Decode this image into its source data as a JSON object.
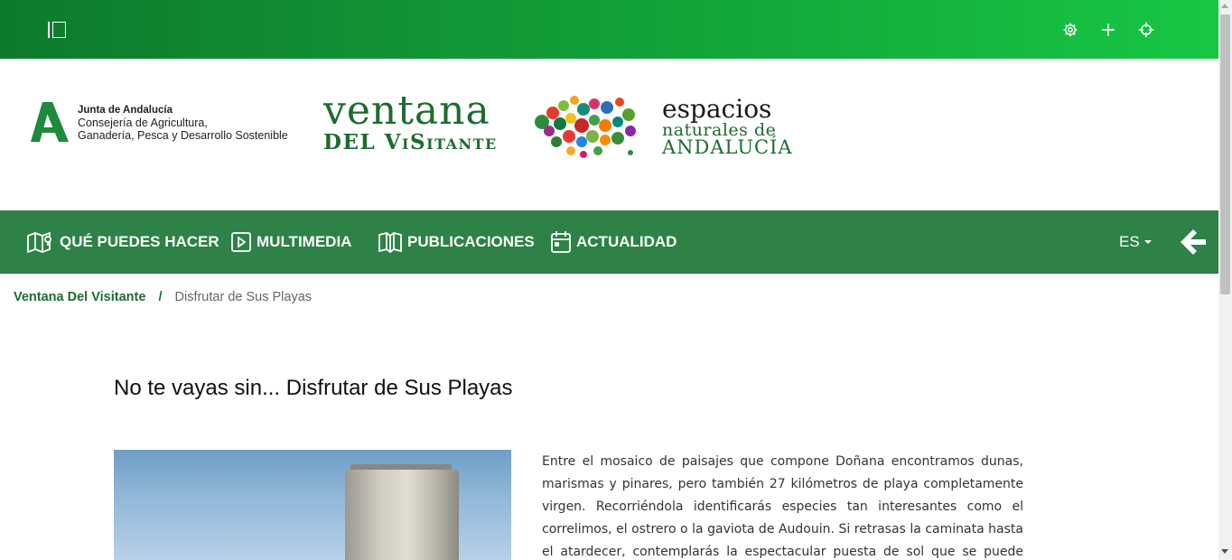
{
  "topbar": {
    "icons": [
      "sidebar-toggle-icon",
      "gear-icon",
      "plus-icon",
      "crosshair-icon"
    ]
  },
  "header": {
    "junta": {
      "title": "Junta de Andalucía",
      "line1": "Consejería de Agricultura,",
      "line2": "Ganadería, Pesca y Desarrollo Sostenible"
    },
    "ventana": {
      "line1": "ventana",
      "line2": "DEL ViSitante"
    },
    "espacios": {
      "line1": "espacios",
      "line2": "naturales de",
      "line3": "ANDALUCÍA"
    }
  },
  "nav": {
    "items": [
      {
        "label": "QUÉ PUEDES HACER",
        "icon": "map-pin-icon"
      },
      {
        "label": "MULTIMEDIA",
        "icon": "play-icon"
      },
      {
        "label": "PUBLICACIONES",
        "icon": "book-icon"
      },
      {
        "label": "ACTUALIDAD",
        "icon": "calendar-icon"
      }
    ],
    "language": "ES",
    "back_icon": "arrow-left-icon"
  },
  "breadcrumb": {
    "home": "Ventana Del Visitante",
    "separator": "/",
    "current": "Disfrutar de Sus Playas"
  },
  "main": {
    "title": "No te vayas sin... Disfrutar de Sus Playas",
    "body": "Entre el mosaico de paisajes que compone Doñana encontramos dunas, marismas y pinares, pero también 27 kilómetros de playa completamente virgen. Recorriéndola identificarás especies tan interesantes como el correlimos, el ostrero o la gaviota de Audouin. Si retrasas la caminata hasta el atardecer, contemplarás la espectacular puesta de sol que se puede disfrutar en este"
  },
  "colors": {
    "topbar_start": "#0e7a2c",
    "topbar_end": "#17c744",
    "nav_bg": "#2e8147",
    "brand_green": "#1e6b2e"
  }
}
